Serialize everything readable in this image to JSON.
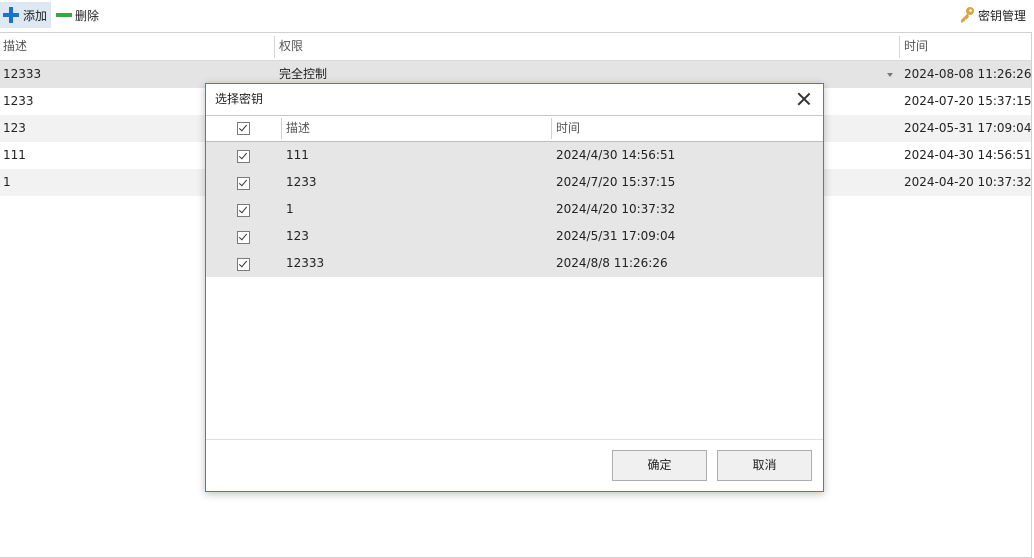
{
  "toolbar": {
    "add_label": "添加",
    "delete_label": "删除",
    "key_manage_label": "密钥管理"
  },
  "grid": {
    "columns": [
      "描述",
      "权限",
      "时间"
    ],
    "rows": [
      {
        "desc": "12333",
        "perm": "完全控制",
        "time": "2024-08-08 11:26:26"
      },
      {
        "desc": "1233",
        "perm": "",
        "time": "2024-07-20 15:37:15"
      },
      {
        "desc": "123",
        "perm": "",
        "time": "2024-05-31 17:09:04"
      },
      {
        "desc": "111",
        "perm": "",
        "time": "2024-04-30 14:56:51"
      },
      {
        "desc": "1",
        "perm": "",
        "time": "2024-04-20 10:37:32"
      }
    ]
  },
  "dialog": {
    "title": "选择密钥",
    "columns": [
      "描述",
      "时间"
    ],
    "rows": [
      {
        "desc": "111",
        "time": "2024/4/30 14:56:51",
        "checked": true
      },
      {
        "desc": "1233",
        "time": "2024/7/20 15:37:15",
        "checked": true
      },
      {
        "desc": "1",
        "time": "2024/4/20 10:37:32",
        "checked": true
      },
      {
        "desc": "123",
        "time": "2024/5/31 17:09:04",
        "checked": true
      },
      {
        "desc": "12333",
        "time": "2024/8/8 11:26:26",
        "checked": true
      }
    ],
    "ok_label": "确定",
    "cancel_label": "取消"
  },
  "colors": {
    "accent_blue": "#1a73c8",
    "delete_green": "#3aa63c",
    "key_gold": "#d9a441",
    "dialog_border": "#3f7fc4"
  },
  "icons": [
    "plus-icon",
    "minus-icon",
    "key-icon",
    "close-icon",
    "checkbox-checked-icon",
    "dropdown-arrow-icon"
  ]
}
